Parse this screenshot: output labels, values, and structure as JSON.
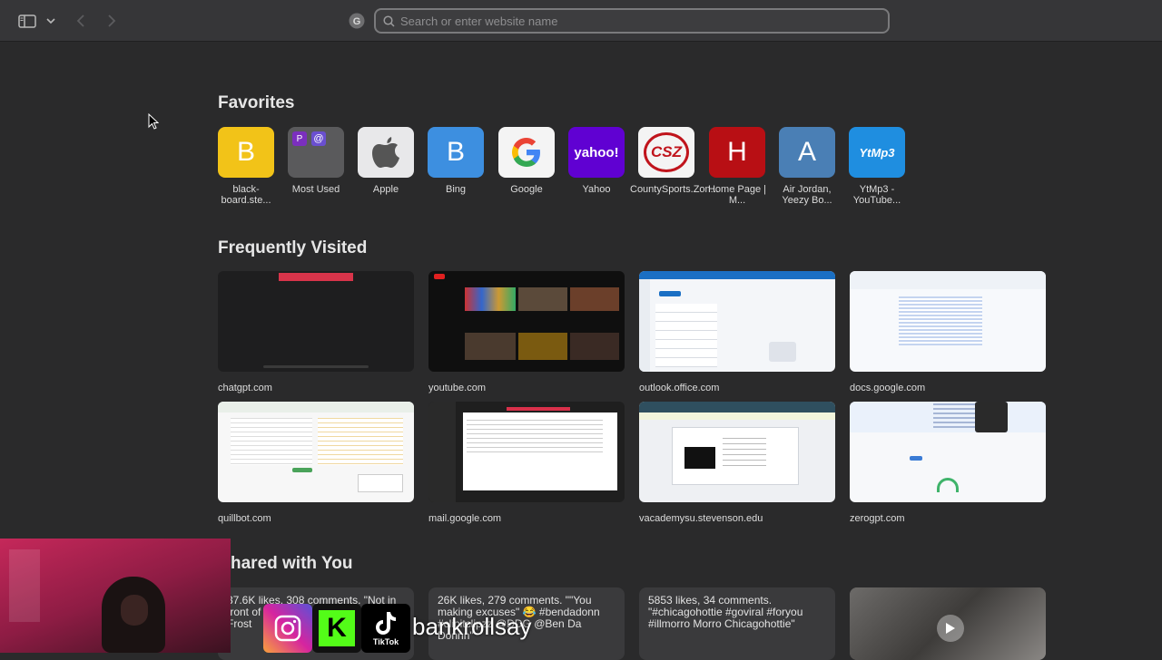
{
  "toolbar": {
    "search_placeholder": "Search or enter website name"
  },
  "favorites": {
    "title": "Favorites",
    "items": [
      {
        "label": "black-board.ste...",
        "glyph": "B",
        "color": "#f2c318"
      },
      {
        "label": "Most Used",
        "glyph": "P @",
        "color": "#5a5a5c"
      },
      {
        "label": "Apple",
        "glyph": "",
        "color": "#e8e8ea"
      },
      {
        "label": "Bing",
        "glyph": "B",
        "color": "#3d8fe0"
      },
      {
        "label": "Google",
        "glyph": "G",
        "color": "#f4f4f4"
      },
      {
        "label": "Yahoo",
        "glyph": "yahoo!",
        "color": "#6001d2"
      },
      {
        "label": "CountySports.Zon...",
        "glyph": "CSZ",
        "color": "#f4f4f4"
      },
      {
        "label": "Home Page | M...",
        "glyph": "H",
        "color": "#b80f14"
      },
      {
        "label": "Air Jordan, Yeezy Bo...",
        "glyph": "A",
        "color": "#4a7fb5"
      },
      {
        "label": "YtMp3 - YouTube...",
        "glyph": "YtMp3",
        "color": "#1f8ee0"
      }
    ]
  },
  "frequently_visited": {
    "title": "Frequently Visited",
    "items": [
      {
        "label": "chatgpt.com"
      },
      {
        "label": "youtube.com"
      },
      {
        "label": "outlook.office.com"
      },
      {
        "label": "docs.google.com"
      },
      {
        "label": "quillbot.com"
      },
      {
        "label": "mail.google.com"
      },
      {
        "label": "vacademysu.stevenson.edu"
      },
      {
        "label": "zerogpt.com"
      }
    ]
  },
  "shared_with_you": {
    "title": "hared with You",
    "items": [
      {
        "text": "37.6K likes, 308 comments. \"Not in front of 😩 #des #yacht @Deshae Frost"
      },
      {
        "text": "26K likes, 279 comments. \"\"You making excuses\" 😂 #bendadonn #clipitclipzz @DDG @Ben Da Donnn\""
      },
      {
        "text": "5853 likes, 34 comments. \"#chicagohottie #goviral #foryou #illmorro Morro Chicagohottie\""
      },
      {
        "text": ""
      }
    ]
  },
  "overlay": {
    "handle": "bankrollsay",
    "tiktok_label": "TikTok",
    "kick_label": "K"
  }
}
